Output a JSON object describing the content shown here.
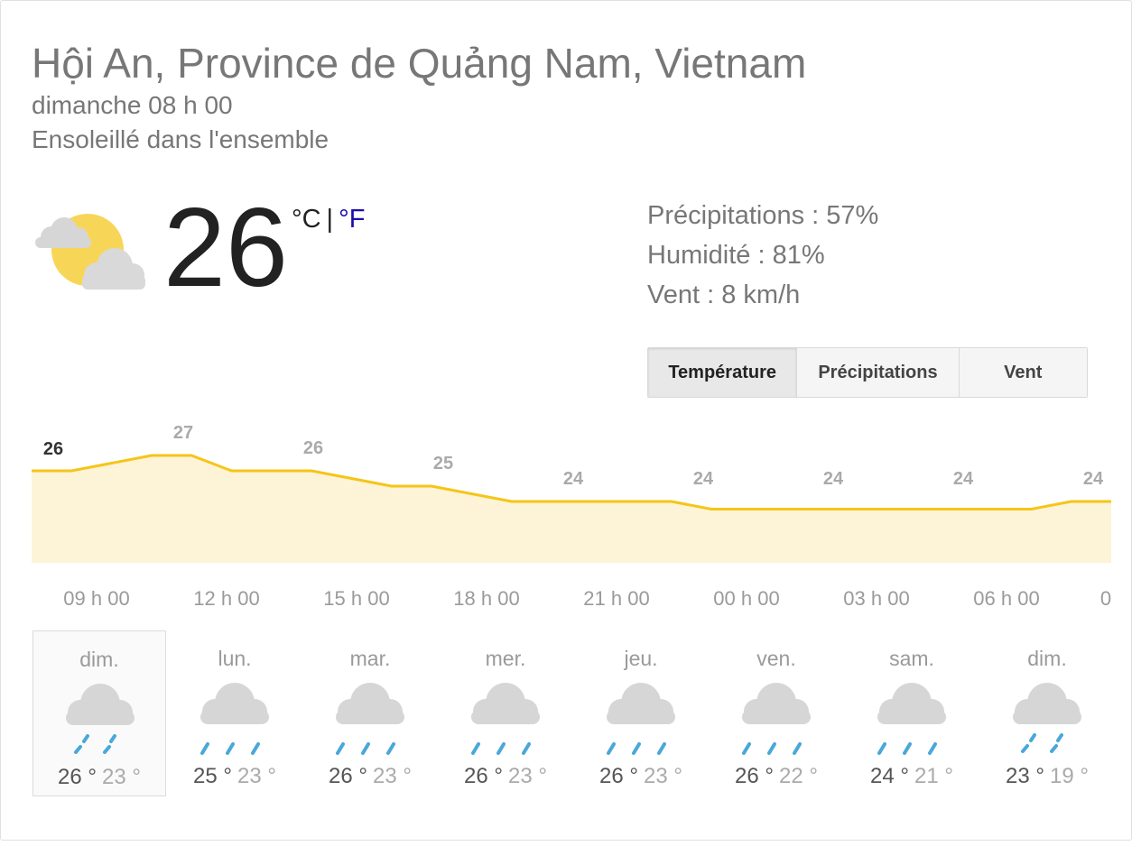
{
  "location": "Hội An, Province de Quảng Nam, Vietnam",
  "datetime": "dimanche 08 h 00",
  "condition": "Ensoleillé dans l'ensemble",
  "current": {
    "icon": "partly-cloudy-icon",
    "temperature": "26",
    "unit_c": "°C",
    "unit_sep": "|",
    "unit_f": "°F"
  },
  "stats": {
    "precipitation": "Précipitations : 57%",
    "humidity": "Humidité : 81%",
    "wind": "Vent : 8 km/h"
  },
  "tabs": [
    {
      "label": "Température",
      "selected": true
    },
    {
      "label": "Précipitations",
      "selected": false
    },
    {
      "label": "Vent",
      "selected": false
    }
  ],
  "colors": {
    "line": "#f5c518",
    "fill": "#fdf3d6",
    "link": "#1a0dab",
    "rain": "#4aa8d8"
  },
  "chart_data": {
    "type": "area",
    "temps": [
      26,
      27,
      26,
      25,
      24,
      24,
      24,
      24,
      24
    ],
    "hours": [
      "09 h 00",
      "12 h 00",
      "15 h 00",
      "18 h 00",
      "21 h 00",
      "00 h 00",
      "03 h 00",
      "06 h 00",
      "0"
    ],
    "series": [
      26,
      26,
      26.5,
      27,
      27,
      26,
      26,
      26,
      25.5,
      25,
      25,
      24.5,
      24,
      24,
      24,
      24,
      24,
      23.5,
      23.5,
      23.5,
      23.5,
      23.5,
      23.5,
      23.5,
      23.5,
      23.5,
      24,
      24
    ]
  },
  "days": [
    {
      "name": "dim.",
      "hi": "26 °",
      "lo": "23 °",
      "icon": "light-rain-icon",
      "selected": true
    },
    {
      "name": "lun.",
      "hi": "25 °",
      "lo": "23 °",
      "icon": "rain-icon",
      "selected": false
    },
    {
      "name": "mar.",
      "hi": "26 °",
      "lo": "23 °",
      "icon": "rain-icon",
      "selected": false
    },
    {
      "name": "mer.",
      "hi": "26 °",
      "lo": "23 °",
      "icon": "rain-icon",
      "selected": false
    },
    {
      "name": "jeu.",
      "hi": "26 °",
      "lo": "23 °",
      "icon": "rain-icon",
      "selected": false
    },
    {
      "name": "ven.",
      "hi": "26 °",
      "lo": "22 °",
      "icon": "rain-icon",
      "selected": false
    },
    {
      "name": "sam.",
      "hi": "24 °",
      "lo": "21 °",
      "icon": "rain-icon",
      "selected": false
    },
    {
      "name": "dim.",
      "hi": "23 °",
      "lo": "19 °",
      "icon": "light-rain-icon",
      "selected": false
    }
  ]
}
